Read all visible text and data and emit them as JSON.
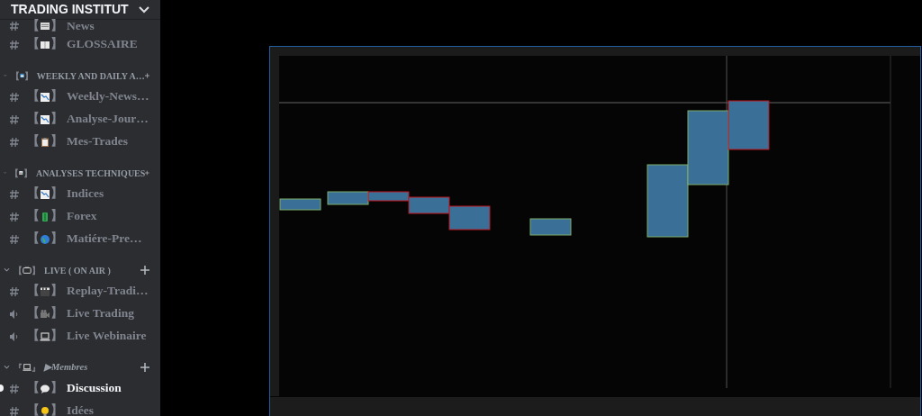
{
  "server": {
    "name": "TRADING INSTITUT"
  },
  "sidebar": {
    "items": [
      {
        "kind": "text_channel",
        "bracket_open": "【",
        "bracket_close": "】",
        "label": "News",
        "unread": false
      },
      {
        "kind": "text_channel",
        "bracket_open": "【",
        "bracket_close": "】",
        "label": "GLOSSAIRE",
        "unread": false
      },
      {
        "kind": "category",
        "bracket_open": "【",
        "bracket_close": "】",
        "label": "WEEKLY AND DAILY A…",
        "italic": false
      },
      {
        "kind": "text_channel",
        "bracket_open": "【",
        "bracket_close": "】",
        "label": "Weekly-News…",
        "unread": false
      },
      {
        "kind": "text_channel",
        "bracket_open": "【",
        "bracket_close": "】",
        "label": "Analyse-Jour…",
        "unread": false
      },
      {
        "kind": "text_channel",
        "bracket_open": "【",
        "bracket_close": "】",
        "label": "Mes-Trades",
        "unread": false
      },
      {
        "kind": "category",
        "bracket_open": "【",
        "bracket_close": "】",
        "label": "ANALYSES TECHNIQUES",
        "italic": false
      },
      {
        "kind": "text_channel",
        "bracket_open": "【",
        "bracket_close": "】",
        "label": "Indices",
        "unread": false
      },
      {
        "kind": "text_channel",
        "bracket_open": "【",
        "bracket_close": "】",
        "label": "Forex",
        "unread": false
      },
      {
        "kind": "text_channel",
        "bracket_open": "【",
        "bracket_close": "】",
        "label": "Matiére-Pre…",
        "unread": false
      },
      {
        "kind": "category",
        "bracket_open": "【",
        "bracket_close": "】",
        "label": "LIVE ( ON AIR )",
        "italic": false
      },
      {
        "kind": "text_channel",
        "bracket_open": "【",
        "bracket_close": "】",
        "label": "Replay-Tradi…",
        "unread": false
      },
      {
        "kind": "voice_channel",
        "bracket_open": "【",
        "bracket_close": "】",
        "label": "Live Trading",
        "unread": false
      },
      {
        "kind": "voice_channel",
        "bracket_open": "【",
        "bracket_close": "】",
        "label": "Live Webinaire",
        "unread": false
      },
      {
        "kind": "category",
        "bracket_open": "『",
        "bracket_close": "』",
        "label": "▶Membres",
        "italic": true
      },
      {
        "kind": "text_channel",
        "bracket_open": "【",
        "bracket_close": "】",
        "label": "Discussion",
        "unread": true
      },
      {
        "kind": "text_channel",
        "bracket_open": "【",
        "bracket_close": "】",
        "label": "Idées",
        "unread": false
      }
    ]
  }
}
